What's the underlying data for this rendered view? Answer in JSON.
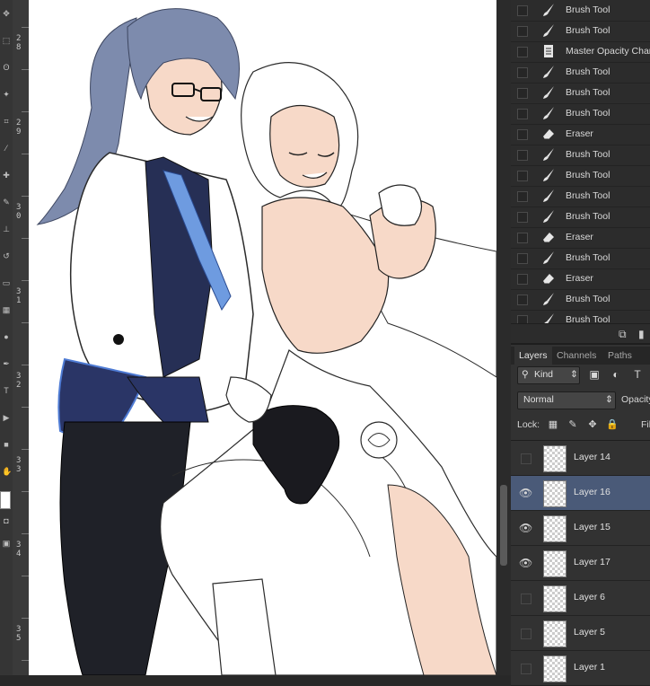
{
  "history": {
    "items": [
      {
        "label": "Brush Tool",
        "icon": "brush-icon"
      },
      {
        "label": "Brush Tool",
        "icon": "brush-icon"
      },
      {
        "label": "Master Opacity Change",
        "icon": "document-icon"
      },
      {
        "label": "Brush Tool",
        "icon": "brush-icon"
      },
      {
        "label": "Brush Tool",
        "icon": "brush-icon"
      },
      {
        "label": "Brush Tool",
        "icon": "brush-icon"
      },
      {
        "label": "Eraser",
        "icon": "eraser-icon"
      },
      {
        "label": "Brush Tool",
        "icon": "brush-icon"
      },
      {
        "label": "Brush Tool",
        "icon": "brush-icon"
      },
      {
        "label": "Brush Tool",
        "icon": "brush-icon"
      },
      {
        "label": "Brush Tool",
        "icon": "brush-icon"
      },
      {
        "label": "Eraser",
        "icon": "eraser-icon"
      },
      {
        "label": "Brush Tool",
        "icon": "brush-icon"
      },
      {
        "label": "Eraser",
        "icon": "eraser-icon"
      },
      {
        "label": "Brush Tool",
        "icon": "brush-icon"
      },
      {
        "label": "Brush Tool",
        "icon": "brush-icon"
      }
    ]
  },
  "layers_panel": {
    "tabs": [
      "Layers",
      "Channels",
      "Paths"
    ],
    "active_tab": "Layers",
    "filter": {
      "kind": "Kind"
    },
    "blend_mode": "Normal",
    "opacity_label": "Opacity",
    "lock_label": "Lock:",
    "fill_label": "Fil",
    "layers": [
      {
        "name": "Layer 14",
        "visible": false,
        "selected": false
      },
      {
        "name": "Layer 16",
        "visible": true,
        "selected": true
      },
      {
        "name": "Layer 15",
        "visible": true,
        "selected": false
      },
      {
        "name": "Layer 17",
        "visible": true,
        "selected": false
      },
      {
        "name": "Layer 6",
        "visible": false,
        "selected": false
      },
      {
        "name": "Layer 5",
        "visible": false,
        "selected": false
      },
      {
        "name": "Layer 1",
        "visible": false,
        "selected": false
      }
    ]
  },
  "ruler": {
    "labels": [
      "2 8",
      "2 9",
      "3 0",
      "3 1",
      "3 2",
      "3 3",
      "3 4",
      "3 5"
    ]
  },
  "colors": {
    "selected_layer": "#4a5a78",
    "skin": "#f7d9c8",
    "hair_male": "#7d8bad",
    "tie": "#6e9be0",
    "vest": "#262f55",
    "panel": "#323232"
  }
}
